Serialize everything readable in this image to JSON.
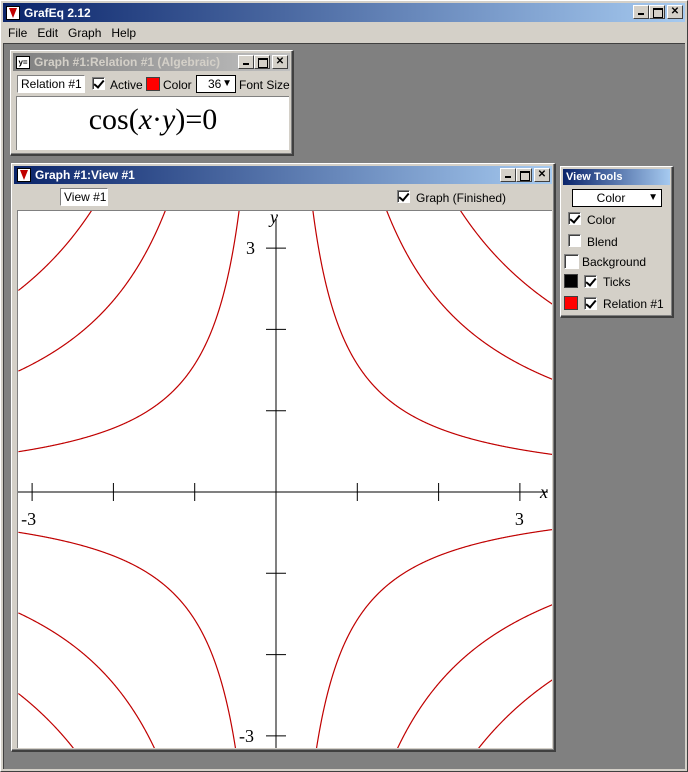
{
  "app": {
    "title": "GrafEq 2.12",
    "menu": [
      "File",
      "Edit",
      "Graph",
      "Help"
    ]
  },
  "relation_window": {
    "title": "Graph #1:Relation #1 (Algebraic)",
    "name_value": "Relation #1",
    "active_label": "Active",
    "active_checked": true,
    "color_label": "Color",
    "color": "#ff0000",
    "font_size_value": "36",
    "font_size_label": "Font Size",
    "formula": {
      "fn": "cos",
      "open": "(",
      "x": "x",
      "dot": "·",
      "y": "y",
      "close": ")",
      "eq": "=",
      "rhs": "0"
    }
  },
  "view_window": {
    "title": "Graph #1:View #1",
    "name_value": "View #1",
    "graph_label": "Graph (Finished)",
    "graph_checked": true
  },
  "view_tools": {
    "title": "View Tools",
    "mode_value": "Color",
    "color_label": "Color",
    "blend_label": "Blend",
    "background_label": "Background",
    "ticks_label": "Ticks",
    "relation_label": "Relation #1",
    "ticks_color": "#000000",
    "relation_color": "#ff0000"
  },
  "chart_data": {
    "type": "line",
    "equation": "cos(x·y)=0",
    "xlabel": "x",
    "ylabel": "y",
    "xlim": [
      -3.1,
      3.1
    ],
    "ylim": [
      -3.1,
      3.1
    ],
    "x_tick_labels": [
      "-3",
      "3"
    ],
    "y_tick_labels": [
      "3",
      "-3"
    ],
    "curve_color": "#c00000",
    "series": [
      {
        "name": "Relation #1",
        "xy_products": [
          -7.853982,
          -4.712389,
          -1.570796,
          1.570796,
          4.712389,
          7.853982
        ]
      }
    ]
  }
}
